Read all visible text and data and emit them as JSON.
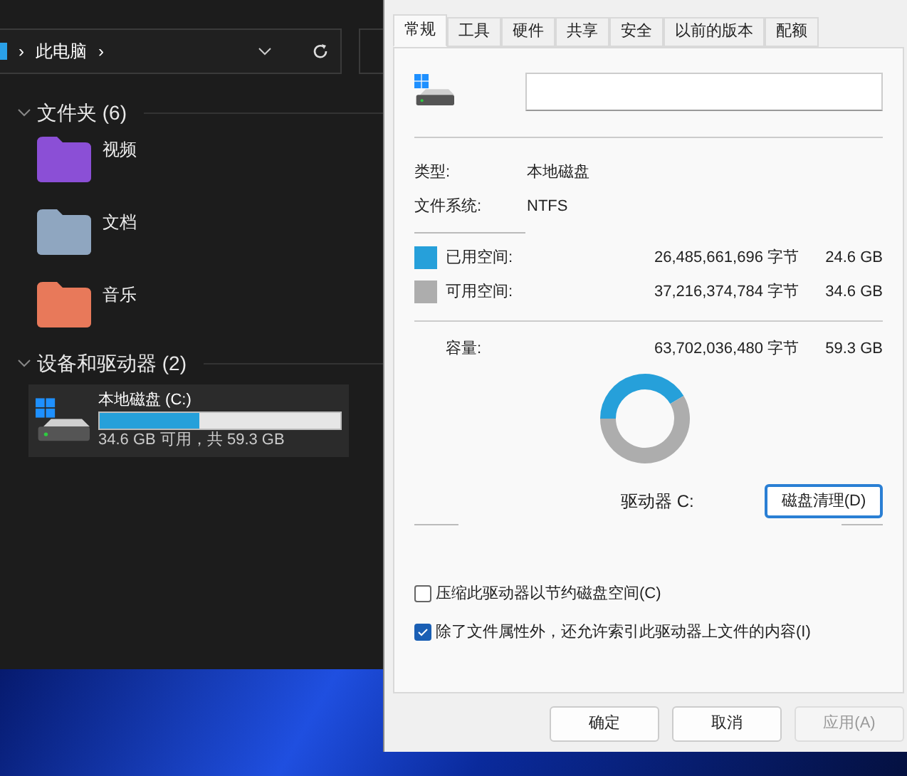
{
  "explorer": {
    "address": {
      "path": "此电脑",
      "separator": "›"
    },
    "sections": [
      {
        "title": "文件夹 (6)",
        "expanded": true,
        "kind": "folders",
        "items": [
          {
            "name": "视频",
            "color": "#8b4fd6"
          },
          {
            "name": "文档",
            "color": "#8fa6c0"
          },
          {
            "name": "音乐",
            "color": "#e8795a"
          }
        ]
      },
      {
        "title": "设备和驱动器 (2)",
        "expanded": true,
        "kind": "drives",
        "items": [
          {
            "name": "本地磁盘 (C:)",
            "level": 0.415,
            "info": "34.6 GB 可用，共 59.3 GB",
            "selected": true
          }
        ]
      }
    ]
  },
  "dialog": {
    "tabs": [
      {
        "label": "常规",
        "selected": true
      },
      {
        "label": "工具",
        "selected": false
      },
      {
        "label": "硬件",
        "selected": false
      },
      {
        "label": "共享",
        "selected": false
      },
      {
        "label": "安全",
        "selected": false
      },
      {
        "label": "以前的版本",
        "selected": false
      },
      {
        "label": "配额",
        "selected": false
      }
    ],
    "properties": [
      {
        "label": "类型:",
        "value": "本地磁盘"
      },
      {
        "label": "文件系统:",
        "value": "NTFS"
      }
    ],
    "space": [
      {
        "label": "已用空间:",
        "bytes": "26,485,661,696 字节",
        "size": "24.6 GB",
        "color": "#26a0da"
      },
      {
        "label": "可用空间:",
        "bytes": "37,216,374,784 字节",
        "size": "34.6 GB",
        "color": "#adadad"
      }
    ],
    "capacity": {
      "label": "容量:",
      "bytes": "63,702,036,480 字节",
      "size": "59.3 GB"
    },
    "drive_label": "驱动器 C:",
    "cleanup_button": "磁盘清理(D)",
    "options": [
      {
        "label": "压缩此驱动器以节约磁盘空间(C)",
        "checked": false
      },
      {
        "label": "除了文件属性外，还允许索引此驱动器上文件的内容(I)",
        "checked": true
      }
    ],
    "buttons": [
      {
        "label": "确定",
        "disabled": false
      },
      {
        "label": "取消",
        "disabled": false
      },
      {
        "label": "应用(A)",
        "disabled": true
      }
    ]
  }
}
